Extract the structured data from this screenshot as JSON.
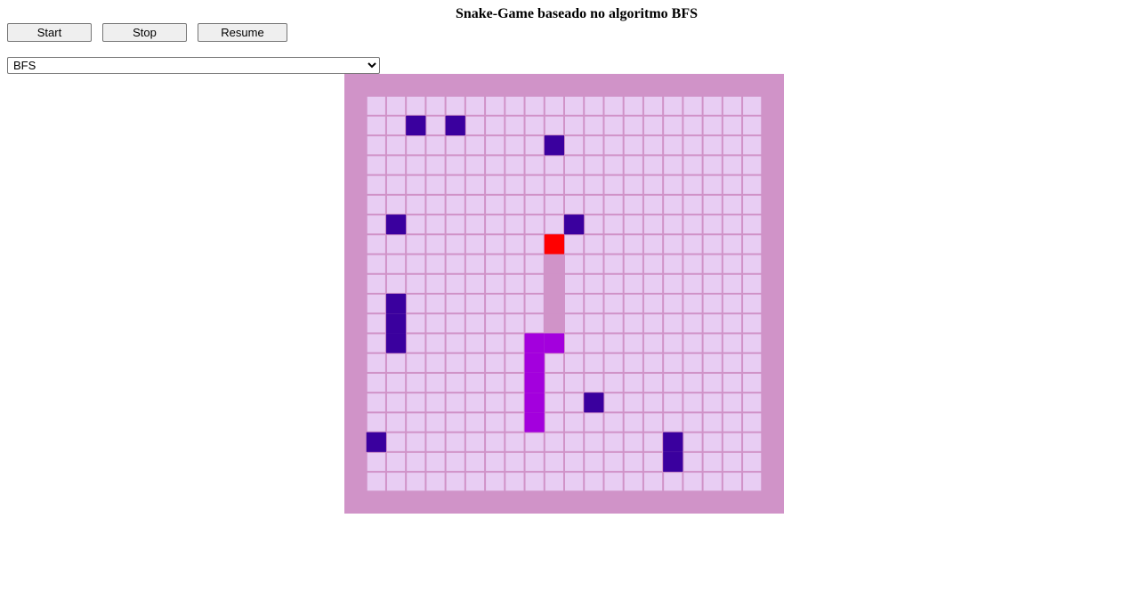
{
  "page": {
    "title": "Snake-Game baseado no algoritmo BFS"
  },
  "controls": {
    "start_label": "Start",
    "stop_label": "Stop",
    "resume_label": "Resume"
  },
  "algorithm_select": {
    "selected": "BFS",
    "options": [
      "BFS"
    ]
  },
  "board": {
    "cols": 20,
    "rows": 20,
    "colors": {
      "border": "#d093c8",
      "cell": "#e8cdf3",
      "grid_line": "#d093c8",
      "obstacle": "#3a009e",
      "food": "#ff0000",
      "snake_head": "#a300dd",
      "snake_body": "#d093c8"
    },
    "food": [
      9,
      7
    ],
    "obstacles": [
      [
        2,
        1
      ],
      [
        4,
        1
      ],
      [
        9,
        2
      ],
      [
        1,
        6
      ],
      [
        10,
        6
      ],
      [
        1,
        10
      ],
      [
        1,
        11
      ],
      [
        1,
        12
      ],
      [
        11,
        15
      ],
      [
        0,
        17
      ],
      [
        15,
        17
      ],
      [
        15,
        18
      ]
    ],
    "snake_head": [
      [
        8,
        12
      ],
      [
        9,
        12
      ],
      [
        8,
        13
      ],
      [
        8,
        14
      ],
      [
        8,
        15
      ],
      [
        8,
        16
      ]
    ],
    "snake_body": [
      [
        9,
        8
      ],
      [
        9,
        9
      ],
      [
        9,
        10
      ],
      [
        9,
        11
      ]
    ]
  }
}
